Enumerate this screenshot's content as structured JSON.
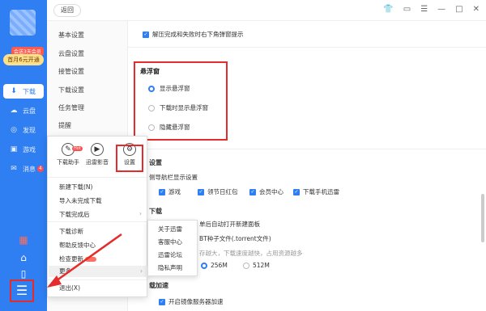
{
  "sidebar": {
    "promo_tag": "会送3天会员",
    "promo_text": "首月6元开通",
    "nav": [
      {
        "icon": "download-icon",
        "glyph": "⬇",
        "label": "下载",
        "active": true
      },
      {
        "icon": "cloud-icon",
        "glyph": "☁",
        "label": "云盘",
        "active": false
      },
      {
        "icon": "discover-icon",
        "glyph": "◎",
        "label": "发现",
        "active": false
      },
      {
        "icon": "gamepad-icon",
        "glyph": "▣",
        "label": "游戏",
        "active": false
      },
      {
        "icon": "message-icon",
        "glyph": "✉",
        "label": "消息",
        "active": false,
        "badge": "4"
      }
    ],
    "menu_glyph": "☰"
  },
  "topbar": {
    "back_label": "返回",
    "icons": [
      "shirt-icon",
      "message-icon",
      "menu-icon",
      "minimize-icon",
      "maximize-icon",
      "close-icon"
    ]
  },
  "settings_nav": [
    "基本设置",
    "云盘设置",
    "接管设置",
    "下载设置",
    "任务管理",
    "提醒"
  ],
  "content": {
    "unzip_check": "解压完成和失败时右下角弹窗提示",
    "float_section": {
      "title": "悬浮窗",
      "options": [
        "显示悬浮窗",
        "下载时显示悬浮窗",
        "隐藏悬浮窗"
      ],
      "selected": 0
    },
    "partial_lines": {
      "settings_header": "设置",
      "nav_bar": "侧导航栏显示设置",
      "games": "游戏",
      "red_packet": "领节日红包",
      "vip": "会员中心",
      "mobile": "下载手机迅雷",
      "download": "下载",
      "auto_open": "单后自动打开新建面板",
      "torrent": "BT种子文件(.torrent文件)",
      "cache_note": "存越大，下载速度越快，占用资源越多",
      "mem_256": "256M",
      "mem_512": "512M",
      "speedup": "载加速",
      "mirror": "开启镜像服务器加速"
    }
  },
  "popup": {
    "tools": [
      {
        "icon": "download-helper-icon",
        "label": "下载助手",
        "badge": "Hot"
      },
      {
        "icon": "xunlei-video-icon",
        "label": "迅雷影音"
      },
      {
        "icon": "settings-icon",
        "label": "设置"
      }
    ],
    "items": [
      {
        "label": "新建下载(N)"
      },
      {
        "label": "导入未完成下载"
      },
      {
        "label": "下载完成后",
        "arrow": true
      },
      {
        "label": "下载诊断"
      },
      {
        "label": "帮助反馈中心"
      },
      {
        "label": "检查更新",
        "new": true
      },
      {
        "label": "更多",
        "arrow": true,
        "highlight": true
      },
      {
        "label": "退出(X)"
      }
    ]
  },
  "submenu": [
    "关于迅雷",
    "客服中心",
    "迅雷论坛",
    "隐私声明"
  ]
}
